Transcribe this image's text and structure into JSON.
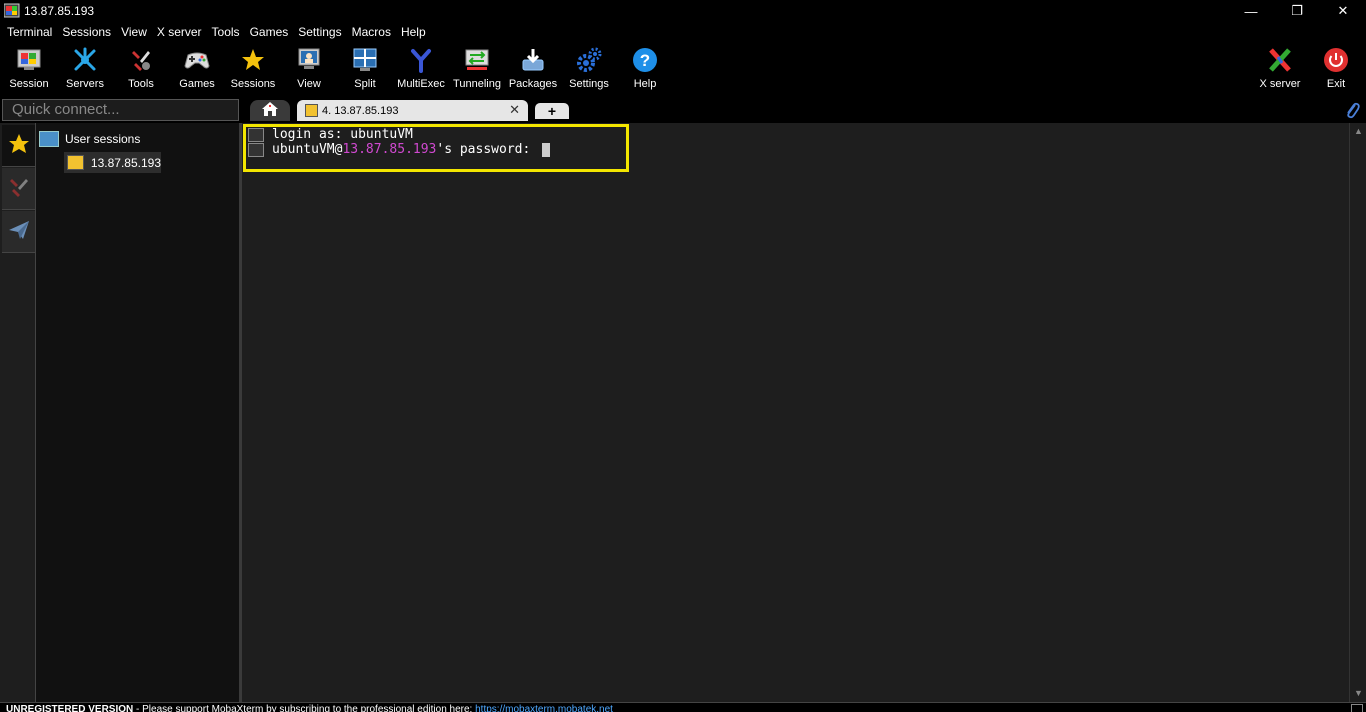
{
  "window": {
    "title": "13.87.85.193",
    "minimize_glyph": "—",
    "maximize_glyph": "❐",
    "close_glyph": "✕"
  },
  "menu": {
    "items": [
      "Terminal",
      "Sessions",
      "View",
      "X server",
      "Tools",
      "Games",
      "Settings",
      "Macros",
      "Help"
    ]
  },
  "toolbar": {
    "session_label": "Session",
    "servers_label": "Servers",
    "tools_label": "Tools",
    "games_label": "Games",
    "sessions_label": "Sessions",
    "view_label": "View",
    "split_label": "Split",
    "multiexec_label": "MultiExec",
    "tunneling_label": "Tunneling",
    "packages_label": "Packages",
    "settings_label": "Settings",
    "help_label": "Help",
    "xserver_label": "X server",
    "exit_label": "Exit"
  },
  "quick_connect": {
    "placeholder": "Quick connect..."
  },
  "tabs": {
    "session_tab_label": "4. 13.87.85.193",
    "close_glyph": "✕",
    "new_tab_glyph": "+"
  },
  "sessions_tree": {
    "root_label": "User sessions",
    "items": [
      {
        "label": "13.87.85.193"
      }
    ]
  },
  "terminal": {
    "line1": "login as: ubuntuVM",
    "line2_user": "ubuntuVM@",
    "line2_host": "13.87.85.193",
    "line2_rest": "'s password: "
  },
  "statusbar": {
    "unregistered": "UNREGISTERED VERSION",
    "message": "  -  Please support MobaXterm by subscribing to the professional edition here:  ",
    "link": "https://mobaxterm.mobatek.net"
  },
  "colors": {
    "highlight_box": "#f3e600",
    "host_magenta": "#d049d0",
    "terminal_bg": "#1e1e1e"
  }
}
